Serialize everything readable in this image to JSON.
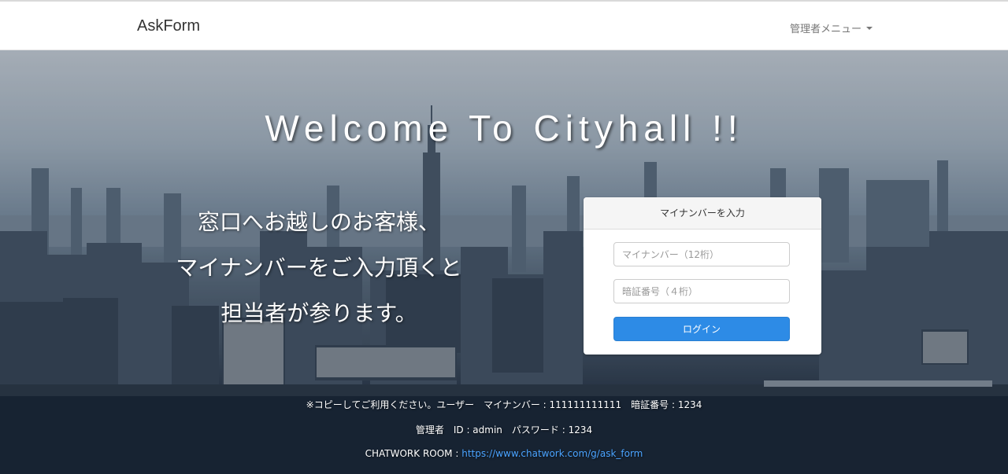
{
  "navbar": {
    "brand": "AskForm",
    "admin_menu": "管理者メニュー"
  },
  "hero": {
    "welcome": "Welcome To Cityhall !!",
    "lead_lines": [
      "窓口へお越しのお客様、",
      "マイナンバーをご入力頂くと",
      "担当者が参ります。"
    ]
  },
  "login_panel": {
    "heading": "マイナンバーを入力",
    "mynumber_placeholder": "マイナンバー（12桁）",
    "pin_placeholder": "暗証番号（４桁）",
    "login_label": "ログイン"
  },
  "info": {
    "line1": "※コピーしてご利用ください。ユーザー　マイナンバー : 111111111111　暗証番号 : 1234",
    "line2": "管理者　ID : admin　パスワード : 1234",
    "line3_label": "CHATWORK ROOM : ",
    "line3_link": "https://www.chatwork.com/g/ask_form"
  },
  "colors": {
    "primary_button": "#2d8be6",
    "link": "#4aa3ff"
  }
}
